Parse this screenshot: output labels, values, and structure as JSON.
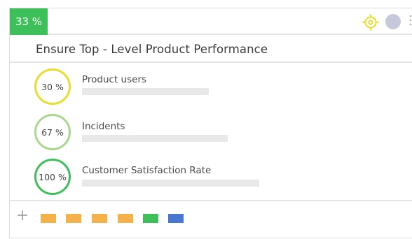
{
  "header": {
    "progress_label": "33 %",
    "progress_color": "#3dbf5a"
  },
  "objective": {
    "title": "Ensure Top - Level Product Performance"
  },
  "key_results": [
    {
      "percent_label": "30 %",
      "progress": 0.3,
      "name": "Product users",
      "ring_color": "#e6de2c"
    },
    {
      "percent_label": "67 %",
      "progress": 0.67,
      "name": "Incidents",
      "ring_color": "#a7d88e"
    },
    {
      "percent_label": "100 %",
      "progress": 1.0,
      "name": "Customer Satisfaction Rate",
      "ring_color": "#3dbf5a"
    }
  ],
  "footer": {
    "add_icon": "plus-icon",
    "color_chips": [
      "#f5b14a",
      "#f5b14a",
      "#f5b14a",
      "#f5b14a",
      "#3dbf5a",
      "#4a78d0"
    ]
  },
  "icons": {
    "target": "target-icon",
    "avatar": "avatar"
  }
}
